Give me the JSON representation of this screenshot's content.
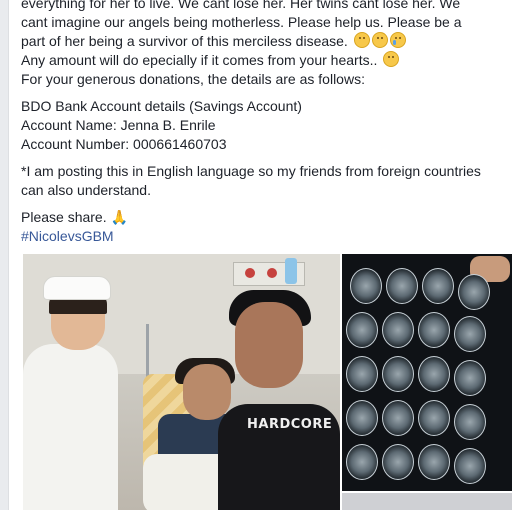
{
  "post": {
    "lines": [
      "everything for her to live. We cant lose her. Her twins cant lose her. We",
      "cant imagine our angels being motherless. Please help us. Please be a",
      "part of her being a survivor of this merciless disease.",
      "Any amount will do epecially if it comes from your hearts..",
      "For your generous donations, the details are as follows:"
    ],
    "bank_title": "BDO Bank Account details (Savings Account)",
    "account_name": "Account Name: Jenna B. Enrile",
    "account_number": "Account Number: 000661460703",
    "note_line1": "*I am posting this in English language so my friends from foreign countries",
    "note_line2": "can also understand.",
    "share": "Please share.",
    "hashtag": "#NicolevsGBM"
  },
  "photos": {
    "left_shirt_text": "HARDCORE",
    "emoji_names": [
      "sad-face-icon",
      "disappointed-face-icon",
      "crying-face-icon",
      "relieved-face-icon",
      "folded-hands-icon"
    ]
  },
  "colors": {
    "text": "#1d2129",
    "link": "#385898",
    "background": "#e9ebee"
  }
}
